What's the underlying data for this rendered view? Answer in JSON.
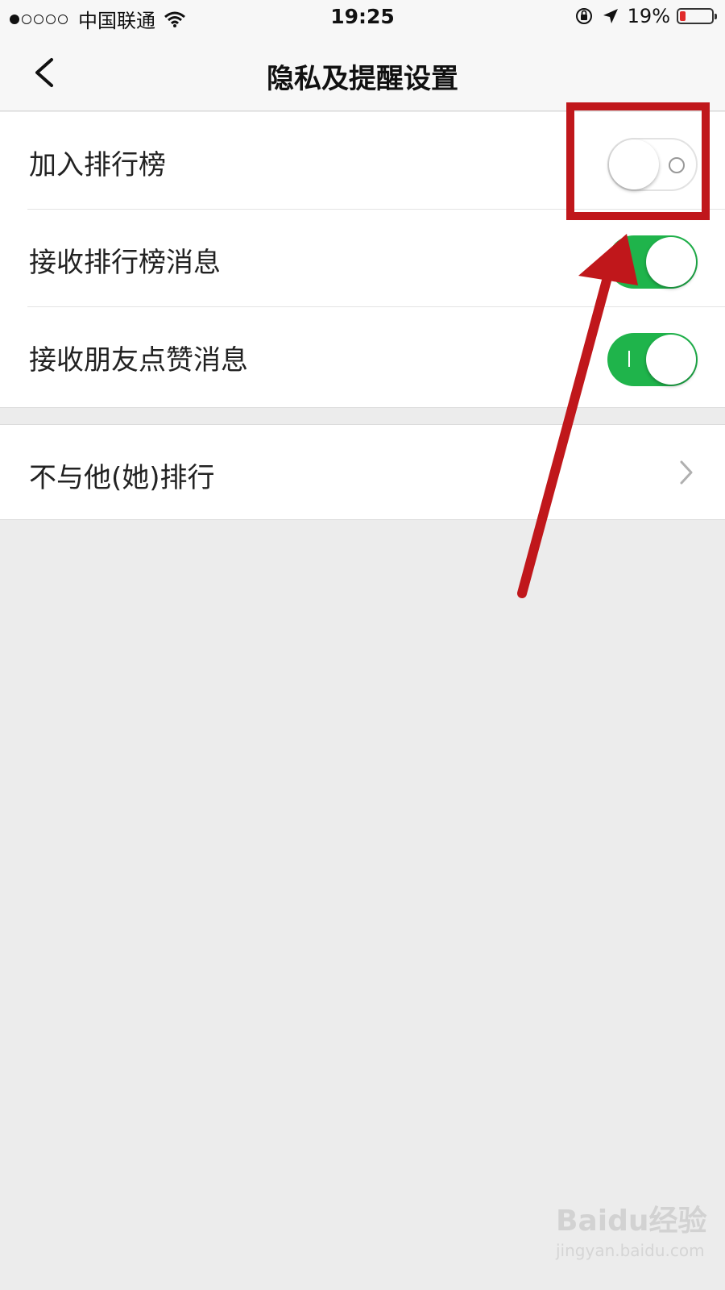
{
  "status_bar": {
    "carrier": "中国联通",
    "time": "19:25",
    "battery_percent": "19%",
    "battery_level": 0.19,
    "signal_bars_filled": 1,
    "signal_bars_total": 5
  },
  "nav": {
    "title": "隐私及提醒设置",
    "back_icon": "chevron-left-icon"
  },
  "settings": [
    {
      "label": "加入排行榜",
      "toggle": "off"
    },
    {
      "label": "接收排行榜消息",
      "toggle": "on"
    },
    {
      "label": "接收朋友点赞消息",
      "toggle": "on"
    }
  ],
  "links": [
    {
      "label": "不与他(她)排行",
      "icon": "chevron-right-icon"
    }
  ],
  "annotation": {
    "color": "#c0171b"
  },
  "colors": {
    "toggle_on": "#1fb44b",
    "background": "#ececec"
  },
  "watermark": {
    "logo": "Baidu经验",
    "sub": "jingyan.baidu.com"
  }
}
